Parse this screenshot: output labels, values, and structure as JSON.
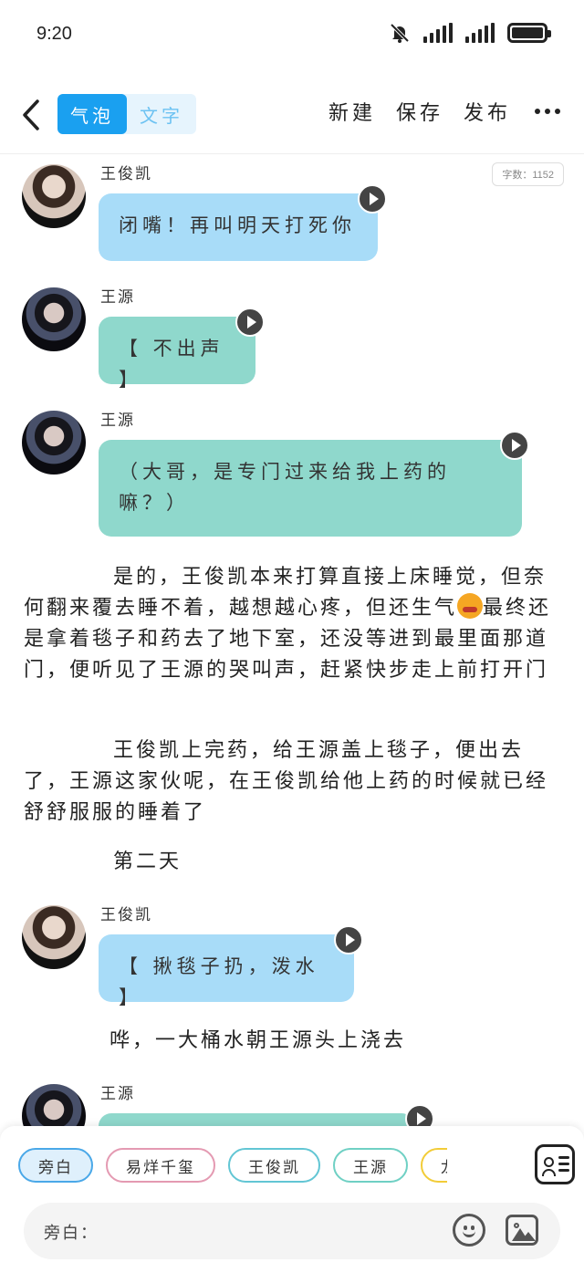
{
  "status_bar": {
    "time": "9:20",
    "icons": [
      "mute-bell-icon",
      "signal-icon",
      "signal-icon",
      "battery-icon"
    ]
  },
  "header": {
    "back_icon": "chevron-left-icon",
    "tabs": [
      {
        "label": "气泡",
        "active": true
      },
      {
        "label": "文字",
        "active": false
      }
    ],
    "actions": [
      {
        "label": "新建"
      },
      {
        "label": "保存"
      },
      {
        "label": "发布"
      }
    ],
    "more_icon": "more-horizontal-icon"
  },
  "word_count": "字数：1152",
  "messages": [
    {
      "type": "bubble",
      "speaker": "王俊凯",
      "text": "闭嘴！再叫明天打死你",
      "color": "#a8dcf8"
    },
    {
      "type": "bubble",
      "speaker": "王源",
      "text": "【 不出声 】",
      "color": "#8fd8cc"
    },
    {
      "type": "bubble",
      "speaker": "王源",
      "text": "（大哥，是专门过来给我上药的嘛？）",
      "color": "#8fd8cc"
    },
    {
      "type": "narration",
      "text": "是的，王俊凯本来打算直接上床睡觉，但奈何翻来覆去睡不着，越想越心疼，但还生气",
      "text_after": "最终还是拿着毯子和药去了地下室，还没等进到最里面那道门，便听见了王源的哭叫声，赶紧快步走上前打开门",
      "emoji": "angry-face-emoji"
    },
    {
      "type": "narration",
      "text": "王俊凯上完药，给王源盖上毯子，便出去了，王源这家伙呢，在王俊凯给他上药的时候就已经舒舒服服的睡着了"
    },
    {
      "type": "narration",
      "text": "第二天"
    },
    {
      "type": "bubble",
      "speaker": "王俊凯",
      "text": "【 揪毯子扔，泼水 】",
      "color": "#a8dcf8"
    },
    {
      "type": "narration",
      "text": "哗，一大桶水朝王源头上浇去"
    },
    {
      "type": "bubble",
      "speaker": "王源",
      "text": "",
      "color": "#8fd8cc"
    }
  ],
  "bottom": {
    "chips": [
      {
        "label": "旁白",
        "selected": true
      },
      {
        "label": "易烊千玺"
      },
      {
        "label": "王俊凯"
      },
      {
        "label": "王源"
      },
      {
        "label": "龙套"
      }
    ],
    "contacts_icon": "contact-card-icon",
    "input_placeholder": "旁白：",
    "emoji_icon": "smiley-icon",
    "image_icon": "image-icon"
  },
  "colors": {
    "accent": "#1aa0f0",
    "kai_bubble": "#a8dcf8",
    "yuan_bubble": "#8fd8cc"
  }
}
